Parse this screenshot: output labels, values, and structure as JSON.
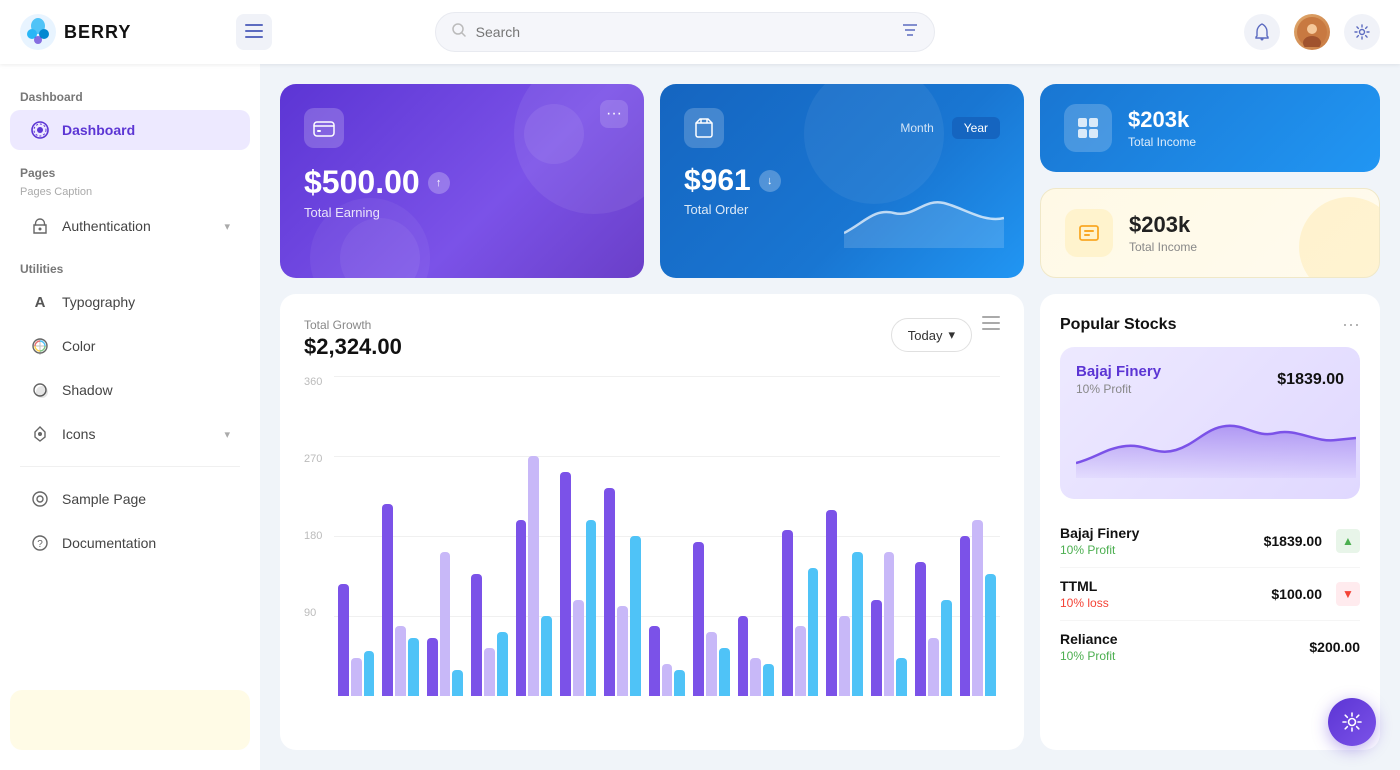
{
  "header": {
    "logo_text": "BERRY",
    "search_placeholder": "Search",
    "menu_icon": "☰",
    "filter_icon": "⚙",
    "bell_icon": "🔔",
    "settings_icon": "⚙"
  },
  "sidebar": {
    "sections": [
      {
        "label": "Dashboard",
        "items": [
          {
            "id": "dashboard",
            "label": "Dashboard",
            "icon": "◎",
            "active": true
          }
        ]
      },
      {
        "label": "Pages",
        "sublabel": "Pages Caption",
        "items": [
          {
            "id": "authentication",
            "label": "Authentication",
            "icon": "🔗",
            "has_chevron": true
          }
        ]
      },
      {
        "label": "Utilities",
        "items": [
          {
            "id": "typography",
            "label": "Typography",
            "icon": "A"
          },
          {
            "id": "color",
            "label": "Color",
            "icon": "◑"
          },
          {
            "id": "shadow",
            "label": "Shadow",
            "icon": "◎"
          },
          {
            "id": "icons",
            "label": "Icons",
            "icon": "✦",
            "has_chevron": true
          }
        ]
      }
    ],
    "bottom_items": [
      {
        "id": "sample-page",
        "label": "Sample Page",
        "icon": "◎"
      },
      {
        "id": "documentation",
        "label": "Documentation",
        "icon": "?"
      }
    ]
  },
  "cards": {
    "earning": {
      "amount": "$500.00",
      "label": "Total Earning",
      "icon": "💳",
      "arrow": "↑"
    },
    "order": {
      "amount": "$961",
      "label": "Total Order",
      "icon": "🛍",
      "tab_month": "Month",
      "tab_year": "Year",
      "arrow": "↓"
    },
    "income_blue": {
      "amount": "$203k",
      "label": "Total Income",
      "icon": "⊞"
    },
    "income_yellow": {
      "amount": "$203k",
      "label": "Total Income",
      "icon": "⊟"
    }
  },
  "chart": {
    "title": "Total Growth",
    "amount": "$2,324.00",
    "btn_label": "Today",
    "y_labels": [
      "360",
      "270",
      "180",
      "90"
    ],
    "bars": [
      {
        "purple": 35,
        "light_purple": 12,
        "blue": 14
      },
      {
        "purple": 60,
        "light_purple": 22,
        "blue": 18
      },
      {
        "purple": 18,
        "light_purple": 45,
        "blue": 8
      },
      {
        "purple": 38,
        "light_purple": 15,
        "blue": 20
      },
      {
        "purple": 55,
        "light_purple": 75,
        "blue": 25
      },
      {
        "purple": 70,
        "light_purple": 30,
        "blue": 55
      },
      {
        "purple": 65,
        "light_purple": 28,
        "blue": 50
      },
      {
        "purple": 22,
        "light_purple": 10,
        "blue": 8
      },
      {
        "purple": 48,
        "light_purple": 20,
        "blue": 15
      },
      {
        "purple": 25,
        "light_purple": 12,
        "blue": 10
      },
      {
        "purple": 52,
        "light_purple": 22,
        "blue": 40
      },
      {
        "purple": 58,
        "light_purple": 25,
        "blue": 45
      },
      {
        "purple": 30,
        "light_purple": 45,
        "blue": 12
      },
      {
        "purple": 42,
        "light_purple": 18,
        "blue": 30
      },
      {
        "purple": 50,
        "light_purple": 55,
        "blue": 38
      }
    ]
  },
  "stocks": {
    "title": "Popular Stocks",
    "featured": {
      "name": "Bajaj Finery",
      "price": "$1839.00",
      "profit_label": "10% Profit"
    },
    "list": [
      {
        "name": "Bajaj Finery",
        "profit": "10% Profit",
        "profit_type": "up",
        "price": "$1839.00",
        "badge": "▲"
      },
      {
        "name": "TTML",
        "profit": "10% loss",
        "profit_type": "down",
        "price": "$100.00",
        "badge": "▼"
      },
      {
        "name": "Reliance",
        "profit": "10% Profit",
        "profit_type": "up",
        "price": "$200.00",
        "badge": ""
      }
    ]
  },
  "fab": {
    "icon": "⚙"
  }
}
